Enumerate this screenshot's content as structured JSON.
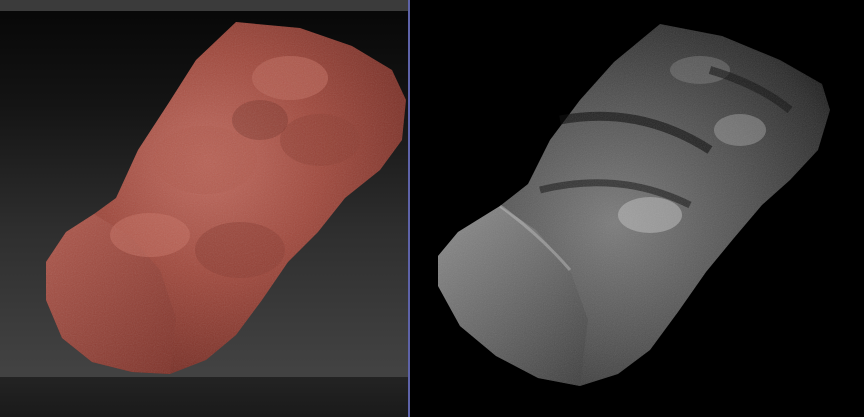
{
  "viewports": {
    "left": {
      "mode": "sculpt-view",
      "material_color": "#a0483c",
      "background_color": "#2e2e2e"
    },
    "right": {
      "mode": "grayscale-render",
      "material_color": "#888888",
      "background_color": "#000000"
    },
    "divider_color": "#5e63a8"
  },
  "objects": [
    {
      "name": "rock-model-sculpt"
    },
    {
      "name": "rock-model-grayscale"
    }
  ]
}
